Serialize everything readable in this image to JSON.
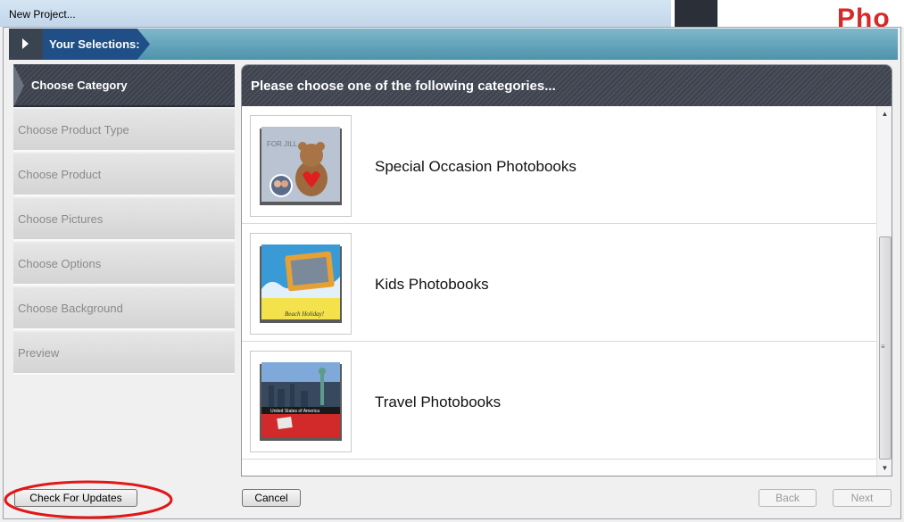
{
  "window": {
    "title": "New Project..."
  },
  "background": {
    "partial_text": "Pho"
  },
  "selections_bar": {
    "label": "Your Selections:"
  },
  "steps": [
    {
      "label": "Choose Category",
      "active": true
    },
    {
      "label": "Choose Product Type",
      "active": false
    },
    {
      "label": "Choose Product",
      "active": false
    },
    {
      "label": "Choose Pictures",
      "active": false
    },
    {
      "label": "Choose Options",
      "active": false
    },
    {
      "label": "Choose Background",
      "active": false
    },
    {
      "label": "Preview",
      "active": false
    }
  ],
  "panel": {
    "heading": "Please choose one of the following categories...",
    "categories": [
      {
        "label": "Special Occasion Photobooks",
        "thumb_text": "FOR JILL"
      },
      {
        "label": "Kids Photobooks",
        "thumb_text": "Beach Holiday!"
      },
      {
        "label": "Travel Photobooks",
        "thumb_text": "United States of America"
      }
    ]
  },
  "buttons": {
    "check_updates": "Check For Updates",
    "cancel": "Cancel",
    "back": "Back",
    "next": "Next"
  },
  "colors": {
    "annotation_circle": "#e01818",
    "nav_active_bg": "#41464f",
    "selections_label_bg": "#1f4f86"
  }
}
